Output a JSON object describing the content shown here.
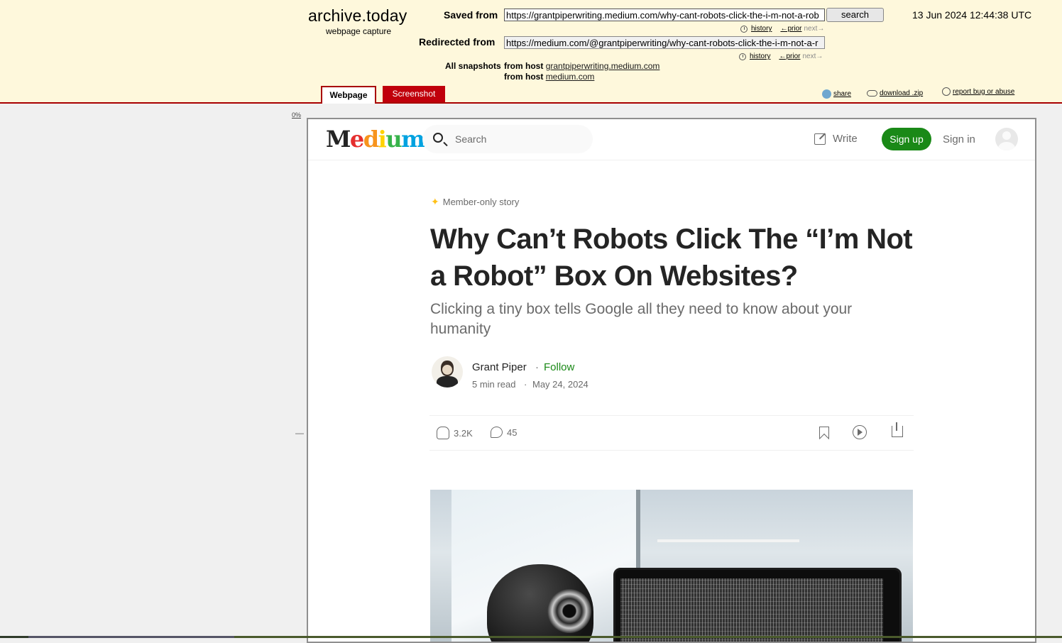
{
  "archive": {
    "brand": "archive.today",
    "brand_sub": "webpage capture",
    "saved_from_label": "Saved from",
    "saved_from_url": "https://grantpiperwriting.medium.com/why-cant-robots-click-the-i-m-not-a-rob",
    "search_label": "search",
    "capture_time": "13 Jun 2024 12:44:38 UTC",
    "history_label": "history",
    "prior_label": "←prior",
    "next_label": "next→",
    "redirected_from_label": "Redirected from",
    "redirected_url": "https://medium.com/@grantpiperwriting/why-cant-robots-click-the-i-m-not-a-r",
    "all_snapshots_label": "All snapshots",
    "from_host_label": "from host",
    "host_1": "grantpiperwriting.medium.com",
    "host_2": "medium.com",
    "tabs": {
      "webpage": "Webpage",
      "screenshot": "Screenshot"
    },
    "tools": {
      "share": "share",
      "download": "download .zip",
      "report": "report bug or abuse"
    },
    "zoom": "0%",
    "zoom_dash": "—"
  },
  "medium": {
    "logo": "Medium",
    "search_placeholder": "Search",
    "write": "Write",
    "sign_up": "Sign up",
    "sign_in": "Sign in",
    "member_label": "Member-only story",
    "title": "Why Can’t Robots Click The “I’m Not a Robot” Box On Websites?",
    "subtitle": "Clicking a tiny box tells Google all they need to know about your humanity",
    "author": "Grant Piper",
    "dot": "·",
    "follow": "Follow",
    "read_time": "5 min read",
    "date": "May 24, 2024",
    "claps": "3.2K",
    "responses": "45",
    "accent": "#1a8917"
  },
  "colors": {
    "archive_bg": "#fef8dc",
    "archive_red": "#a80000",
    "logo_colors": [
      "#e52e2e",
      "#f7941d",
      "#ffd200",
      "#37b34a",
      "#00a2e0",
      "#2e3192",
      "#92278f"
    ]
  }
}
